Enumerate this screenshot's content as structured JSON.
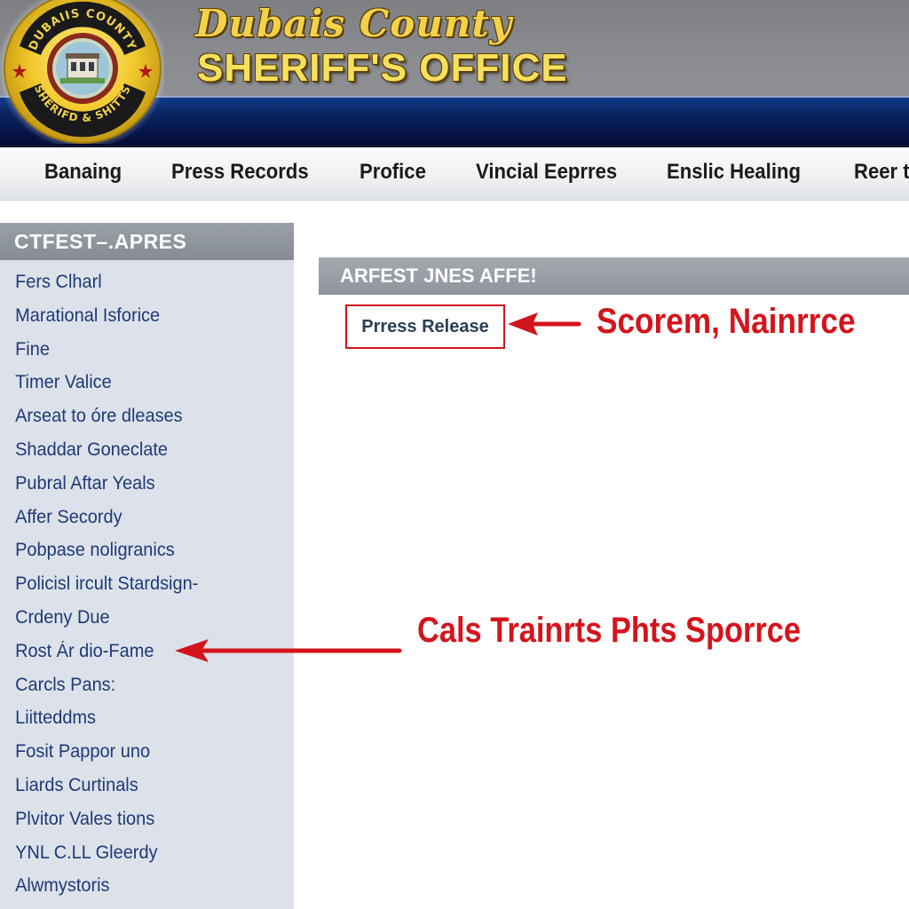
{
  "header": {
    "badge_icon": "sheriff-badge",
    "badge_top_text": "DUBAIIS COUNTY",
    "badge_bottom_text": "SHERIFD & SHITTS",
    "title_script": "Dubais County",
    "title_main": "SHERIFF'S OFFICE"
  },
  "nav": {
    "items": [
      {
        "label": "Banaing"
      },
      {
        "label": "Press Records"
      },
      {
        "label": "Profice"
      },
      {
        "label": "Vincial Eeprres"
      },
      {
        "label": "Enslic Healing"
      },
      {
        "label": "Reer t"
      }
    ]
  },
  "sidebar": {
    "header": "CTFEST–.APRES",
    "items": [
      {
        "label": "Fers Clharl"
      },
      {
        "label": "Marational Isforice"
      },
      {
        "label": "Fine"
      },
      {
        "label": "Timer Valice"
      },
      {
        "label": "Arseat to óre dleases"
      },
      {
        "label": "Shaddar Goneclate"
      },
      {
        "label": "Pubral Aftar Yeals"
      },
      {
        "label": "Affer Secordy"
      },
      {
        "label": "Pobpase noligranics"
      },
      {
        "label": "Policisl ircult Stardsign-"
      },
      {
        "label": "Crdeny Due"
      },
      {
        "label": "Rost Ár dio-Fame"
      },
      {
        "label": "Carcls Pans:"
      },
      {
        "label": "Liitteddms"
      },
      {
        "label": "Fosit Pappor uno"
      },
      {
        "label": "Liards Curtinals"
      },
      {
        "label": "Plvitor Vales tions"
      },
      {
        "label": "YNL C.LL Gleerdy"
      },
      {
        "label": "Alwmystoris"
      }
    ]
  },
  "main": {
    "section_title": "ARFEST JNES AFFE!",
    "press_release_link": "Prress Release"
  },
  "annotations": {
    "top_label": "Scorem, Nainrrce",
    "bottom_label": "Cals Trainrts  Phts Sporrce",
    "color": "#d4141c"
  }
}
